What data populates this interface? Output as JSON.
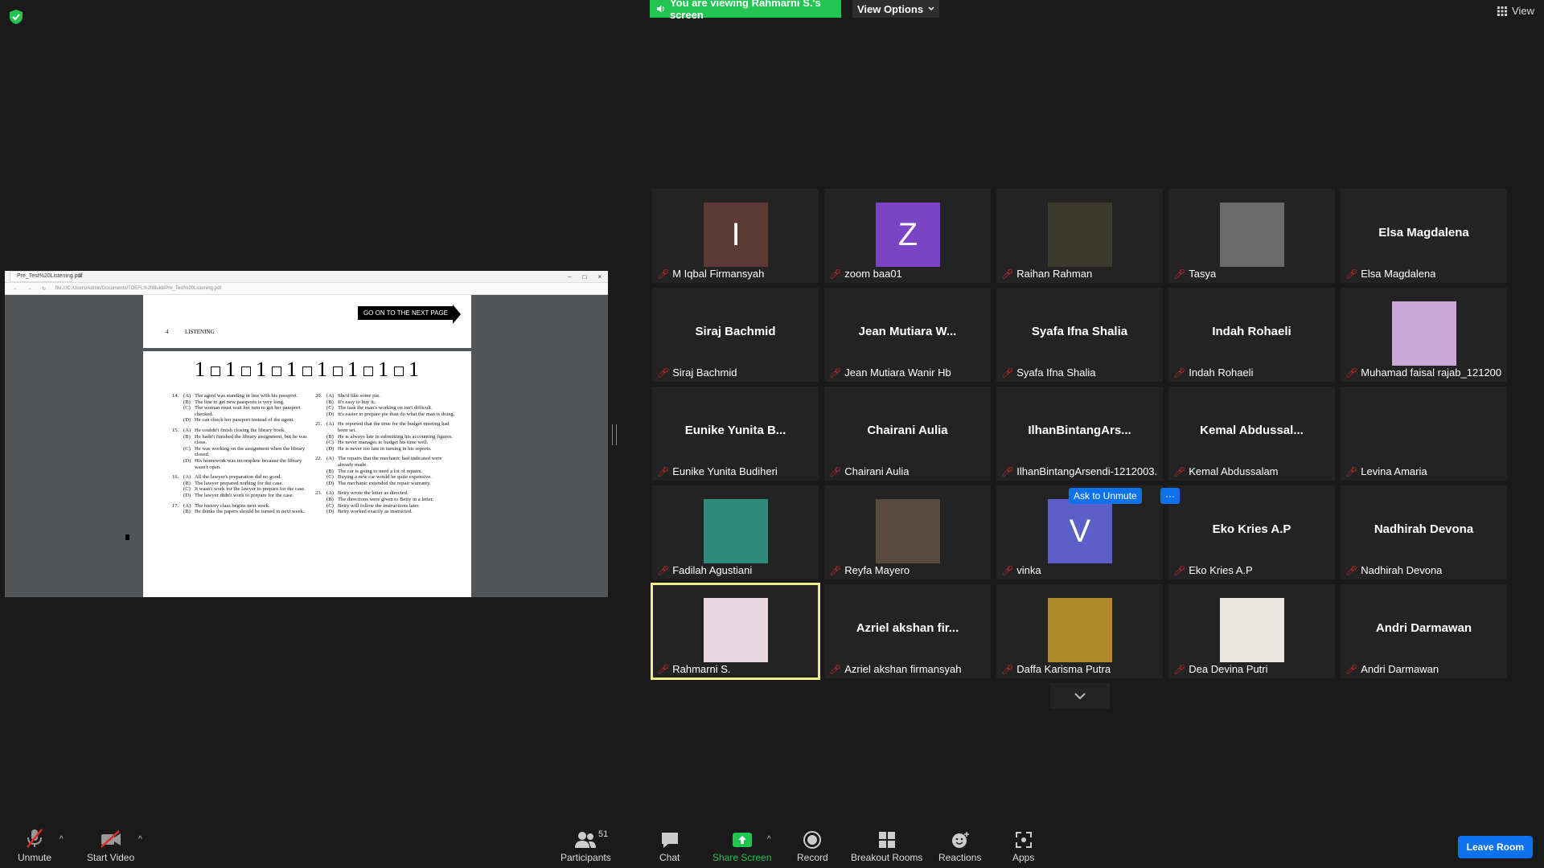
{
  "banner": {
    "viewing": "You are viewing Rahmarni S.'s screen",
    "view_options": "View Options",
    "view": "View"
  },
  "shared_screen": {
    "tab_title": "Pre_Test%20Listening.pdf",
    "address": "file:///C:/Users/Admin/Documents/TOEFL%20Bukti/Pre_Test%20Listening.pdf",
    "goto": "GO ON TO THE NEXT PAGE",
    "page_number": "4",
    "section": "LISTENING",
    "strip": [
      "1",
      "1",
      "1",
      "1",
      "1",
      "1",
      "1",
      "1"
    ],
    "left_questions": [
      {
        "n": "14.",
        "opts": [
          [
            "(A)",
            "The agent was standing in line with his passport."
          ],
          [
            "(B)",
            "The line to get new passports is very long."
          ],
          [
            "(C)",
            "The woman must wait her turn to get her passport checked."
          ],
          [
            "(D)",
            "He can check her passport instead of the agent."
          ]
        ]
      },
      {
        "n": "15.",
        "opts": [
          [
            "(A)",
            "He couldn't finish closing the library book."
          ],
          [
            "(B)",
            "He hadn't finished the library assignment, but he was close."
          ],
          [
            "(C)",
            "He was working on the assignment when the library closed."
          ],
          [
            "(D)",
            "His homework was incomplete because the library wasn't open."
          ]
        ]
      },
      {
        "n": "16.",
        "opts": [
          [
            "(A)",
            "All the lawyer's preparation did no good."
          ],
          [
            "(B)",
            "The lawyer prepared nothing for the case."
          ],
          [
            "(C)",
            "It wasn't work for the lawyer to prepare for the case."
          ],
          [
            "(D)",
            "The lawyer didn't work to prepare for the case."
          ]
        ]
      },
      {
        "n": "17.",
        "opts": [
          [
            "(A)",
            "The history class begins next week."
          ],
          [
            "(B)",
            "He thinks the papers should be turned in next week."
          ]
        ]
      }
    ],
    "right_questions": [
      {
        "n": "20.",
        "opts": [
          [
            "(A)",
            "She'd like some pie."
          ],
          [
            "(B)",
            "It's easy to buy it."
          ],
          [
            "(C)",
            "The task the man's working on isn't difficult."
          ],
          [
            "(D)",
            "It's easier to prepare pie than do what the man is doing."
          ]
        ]
      },
      {
        "n": "21.",
        "opts": [
          [
            "(A)",
            "He reported that the time for the budget meeting had been set."
          ],
          [
            "(B)",
            "He is always late in submitting his accounting figures."
          ],
          [
            "(C)",
            "He never manages to budget his time well."
          ],
          [
            "(D)",
            "He is never too late in turning in his reports."
          ]
        ]
      },
      {
        "n": "22.",
        "opts": [
          [
            "(A)",
            "The repairs that the mechanic had indicated were already made."
          ],
          [
            "(B)",
            "The car is going to need a lot of repairs."
          ],
          [
            "(C)",
            "Buying a new car would be quite expensive."
          ],
          [
            "(D)",
            "The mechanic extended the repair warranty."
          ]
        ]
      },
      {
        "n": "23.",
        "opts": [
          [
            "(A)",
            "Betty wrote the letter as directed."
          ],
          [
            "(B)",
            "The directions were given to Betty in a letter."
          ],
          [
            "(C)",
            "Betty will follow the instructions later."
          ],
          [
            "(D)",
            "Betty worked exactly as instructed."
          ]
        ]
      }
    ]
  },
  "participants": [
    {
      "name": "M Iqbal Firmansyah",
      "display": "",
      "type": "letter",
      "letter": "I",
      "color": "#5a3a33"
    },
    {
      "name": "zoom baa01",
      "display": "",
      "type": "letter",
      "letter": "Z",
      "color": "#7b44c4"
    },
    {
      "name": "Raihan Rahman",
      "display": "",
      "type": "photo",
      "color": "#3b3a2c"
    },
    {
      "name": "Tasya",
      "display": "",
      "type": "photo",
      "color": "#6b6b6b"
    },
    {
      "name": "Elsa Magdalena",
      "display": "Elsa Magdalena",
      "type": "text"
    },
    {
      "name": "Siraj Bachmid",
      "display": "Siraj Bachmid",
      "type": "text"
    },
    {
      "name": "Jean Mutiara Wanir Hb",
      "display": "Jean Mutiara W...",
      "type": "text"
    },
    {
      "name": "Syafa Ifna Shalia",
      "display": "Syafa Ifna Shalia",
      "type": "text"
    },
    {
      "name": "Indah Rohaeli",
      "display": "Indah Rohaeli",
      "type": "text"
    },
    {
      "name": "Muhamad faisal rajab_121200...",
      "display": "",
      "type": "photo",
      "color": "#c9a8d8"
    },
    {
      "name": "Eunike Yunita Budiheri",
      "display": "Eunike Yunita B...",
      "type": "text"
    },
    {
      "name": "Chairani Aulia",
      "display": "Chairani Aulia",
      "type": "text"
    },
    {
      "name": "IlhanBintangArsendi-1212003...",
      "display": "IlhanBintangArs...",
      "type": "text"
    },
    {
      "name": "Kemal Abdussalam",
      "display": "Kemal Abdussal...",
      "type": "text"
    },
    {
      "name": "Levina Amaria",
      "display": "",
      "type": "blank"
    },
    {
      "name": "Fadilah Agustiani",
      "display": "",
      "type": "photo",
      "color": "#2e8a7a"
    },
    {
      "name": "Reyfa Mayero",
      "display": "",
      "type": "photo",
      "color": "#5a4a3c"
    },
    {
      "name": "vinka",
      "display": "",
      "type": "letter",
      "letter": "V",
      "color": "#5b5fc7"
    },
    {
      "name": "Eko Kries A.P",
      "display": "Eko Kries A.P",
      "type": "text"
    },
    {
      "name": "Nadhirah Devona",
      "display": "Nadhirah Devona",
      "type": "text"
    },
    {
      "name": "Rahmarni S.",
      "display": "",
      "type": "photo",
      "color": "#e8d7e0",
      "active": true
    },
    {
      "name": "Azriel akshan firmansyah",
      "display": "Azriel akshan fir...",
      "type": "text"
    },
    {
      "name": "Daffa Karisma Putra",
      "display": "",
      "type": "photo",
      "color": "#b08a2a"
    },
    {
      "name": "Dea Devina Putri",
      "display": "",
      "type": "photo",
      "color": "#e9e6e2"
    },
    {
      "name": "Andri Darmawan",
      "display": "Andri Darmawan",
      "type": "text"
    }
  ],
  "hover": {
    "ask_to_unmute": "Ask to Unmute",
    "more": "···"
  },
  "toolbar": {
    "unmute": "Unmute",
    "start_video": "Start Video",
    "participants": "Participants",
    "participant_count": "51",
    "chat": "Chat",
    "share_screen": "Share Screen",
    "record": "Record",
    "breakout_rooms": "Breakout Rooms",
    "reactions": "Reactions",
    "apps": "Apps",
    "leave_room": "Leave Room"
  },
  "colors": {
    "banner_green": "#23c552",
    "accent_blue": "#0e72ed",
    "muted_red": "#e02828",
    "active_speaker": "#f0ec8a"
  }
}
